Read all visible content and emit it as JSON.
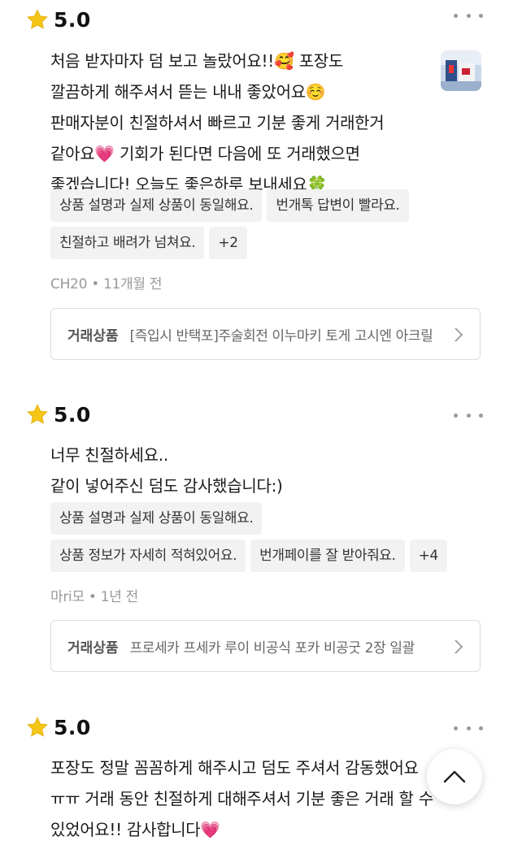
{
  "star_icon_color": "#f5c518",
  "reviews": [
    {
      "score": "5.0",
      "text": "처음 받자마자 덤 보고 놀랐어요!!🥰 포장도\n깔끔하게 해주셔서 뜯는 내내 좋았어요☺️\n판매자분이 친절하셔서 빠르고 기분 좋게 거래한거\n같아요💗 기회가 된다면 다음에 또 거래했으면\n좋겠습니다! 오늘도 좋은하루 보내세요🍀",
      "tags": [
        "상품 설명과 실제 상품이 동일해요.",
        "번개톡 답변이 빨라요.",
        "친절하고 배려가 넘쳐요.",
        "+2"
      ],
      "meta": "CH20 • 11개월 전",
      "product_label": "거래상품",
      "product_name": "[즉입시 반택포]주술회전 이누마키 토게 고시엔 아크릴"
    },
    {
      "score": "5.0",
      "text": "너무 친절하세요..\n같이 넣어주신 덤도 감사했습니다:)",
      "tags": [
        "상품 설명과 실제 상품이 동일해요.",
        "상품 정보가 자세히 적혀있어요.",
        "번개페이를 잘 받아줘요.",
        "+4"
      ],
      "meta": "마ri모 • 1년 전",
      "product_label": "거래상품",
      "product_name": "프로세카 프세카 루이 비공식 포카 비공굿 2장 일괄"
    },
    {
      "score": "5.0",
      "text": "포장도 정말 꼼꼼하게 해주시고 덤도 주셔서 감동했어요\nㅠㅠ 거래 동안 친절하게 대해주셔서 기분 좋은 거래 할 수\n있었어요!! 감사합니다💗"
    }
  ]
}
